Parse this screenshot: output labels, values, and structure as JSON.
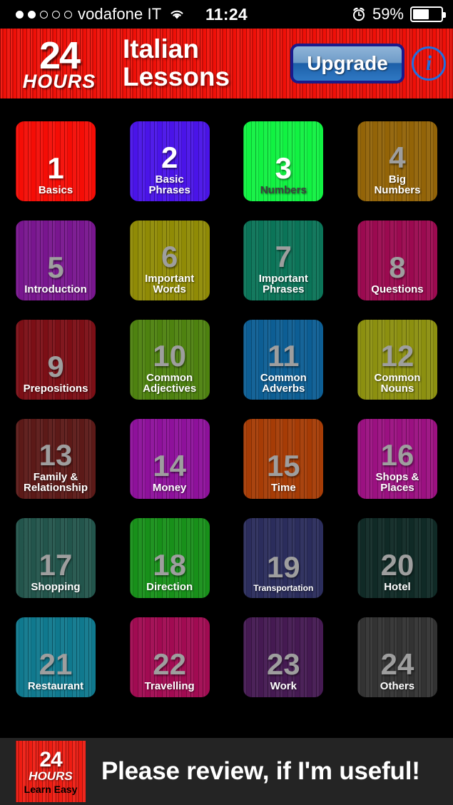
{
  "statusbar": {
    "carrier": "vodafone IT",
    "time": "11:24",
    "battery_percent": "59%",
    "signal_filled": 2,
    "signal_total": 5,
    "wifi_icon": "wifi-icon",
    "alarm_icon": "alarm-clock-icon"
  },
  "header": {
    "logo_number": "24",
    "logo_hours": "HOURS",
    "title_line1": "Italian",
    "title_line2": "Lessons",
    "upgrade_label": "Upgrade",
    "info_label": "i",
    "bg_color": "#f01008"
  },
  "tiles": [
    {
      "number": "1",
      "label": "Basics",
      "bg": "#f50d06",
      "num_color": "#ffffff",
      "label_color": "#ffffff"
    },
    {
      "number": "2",
      "label": "Basic\nPhrases",
      "bg": "#4a14e8",
      "num_color": "#ffffff",
      "label_color": "#ffffff"
    },
    {
      "number": "3",
      "label": "Numbers",
      "bg": "#11f242",
      "num_color": "#ffffff",
      "label_color": "#3f3f3f"
    },
    {
      "number": "4",
      "label": "Big\nNumbers",
      "bg": "#936408",
      "num_color": "#9e9e9e",
      "label_color": "#ffffff"
    },
    {
      "number": "5",
      "label": "Introduction",
      "bg": "#79168f",
      "num_color": "#9e9e9e",
      "label_color": "#ffffff"
    },
    {
      "number": "6",
      "label": "Important\nWords",
      "bg": "#908b06",
      "num_color": "#9e9e9e",
      "label_color": "#ffffff"
    },
    {
      "number": "7",
      "label": "Important\nPhrases",
      "bg": "#0b7458",
      "num_color": "#9e9e9e",
      "label_color": "#ffffff"
    },
    {
      "number": "8",
      "label": "Questions",
      "bg": "#9b0a50",
      "num_color": "#9e9e9e",
      "label_color": "#ffffff"
    },
    {
      "number": "9",
      "label": "Prepositions",
      "bg": "#7c0f16",
      "num_color": "#9e9e9e",
      "label_color": "#ffffff"
    },
    {
      "number": "10",
      "label": "Common\nAdjectives",
      "bg": "#4e8210",
      "num_color": "#9e9e9e",
      "label_color": "#ffffff"
    },
    {
      "number": "11",
      "label": "Common\nAdverbs",
      "bg": "#0d5e94",
      "num_color": "#9e9e9e",
      "label_color": "#ffffff"
    },
    {
      "number": "12",
      "label": "Common\nNouns",
      "bg": "#8c9010",
      "num_color": "#9e9e9e",
      "label_color": "#ffffff"
    },
    {
      "number": "13",
      "label": "Family &\nRelationship",
      "bg": "#5c1a18",
      "num_color": "#9e9e9e",
      "label_color": "#ffffff"
    },
    {
      "number": "14",
      "label": "Money",
      "bg": "#8e119b",
      "num_color": "#9e9e9e",
      "label_color": "#ffffff"
    },
    {
      "number": "15",
      "label": "Time",
      "bg": "#a63c06",
      "num_color": "#9e9e9e",
      "label_color": "#ffffff"
    },
    {
      "number": "16",
      "label": "Shops &\nPlaces",
      "bg": "#9b1181",
      "num_color": "#9e9e9e",
      "label_color": "#ffffff"
    },
    {
      "number": "17",
      "label": "Shopping",
      "bg": "#23554c",
      "num_color": "#9e9e9e",
      "label_color": "#ffffff"
    },
    {
      "number": "18",
      "label": "Direction",
      "bg": "#18901a",
      "num_color": "#9e9e9e",
      "label_color": "#ffffff"
    },
    {
      "number": "19",
      "label": "Transportation",
      "bg": "#2b2d5c",
      "num_color": "#9e9e9e",
      "label_color": "#ffffff"
    },
    {
      "number": "20",
      "label": "Hotel",
      "bg": "#102a26",
      "num_color": "#9e9e9e",
      "label_color": "#ffffff"
    },
    {
      "number": "21",
      "label": "Restaurant",
      "bg": "#10798e",
      "num_color": "#9e9e9e",
      "label_color": "#ffffff"
    },
    {
      "number": "22",
      "label": "Travelling",
      "bg": "#a10b52",
      "num_color": "#9e9e9e",
      "label_color": "#ffffff"
    },
    {
      "number": "23",
      "label": "Work",
      "bg": "#451a52",
      "num_color": "#9e9e9e",
      "label_color": "#ffffff"
    },
    {
      "number": "24",
      "label": "Others",
      "bg": "#333333",
      "num_color": "#9e9e9e",
      "label_color": "#ffffff"
    }
  ],
  "banner": {
    "logo_number": "24",
    "logo_hours": "HOURS",
    "logo_tagline": "Learn Easy",
    "message": "Please review, if I'm useful!",
    "bg_color": "#242424"
  }
}
